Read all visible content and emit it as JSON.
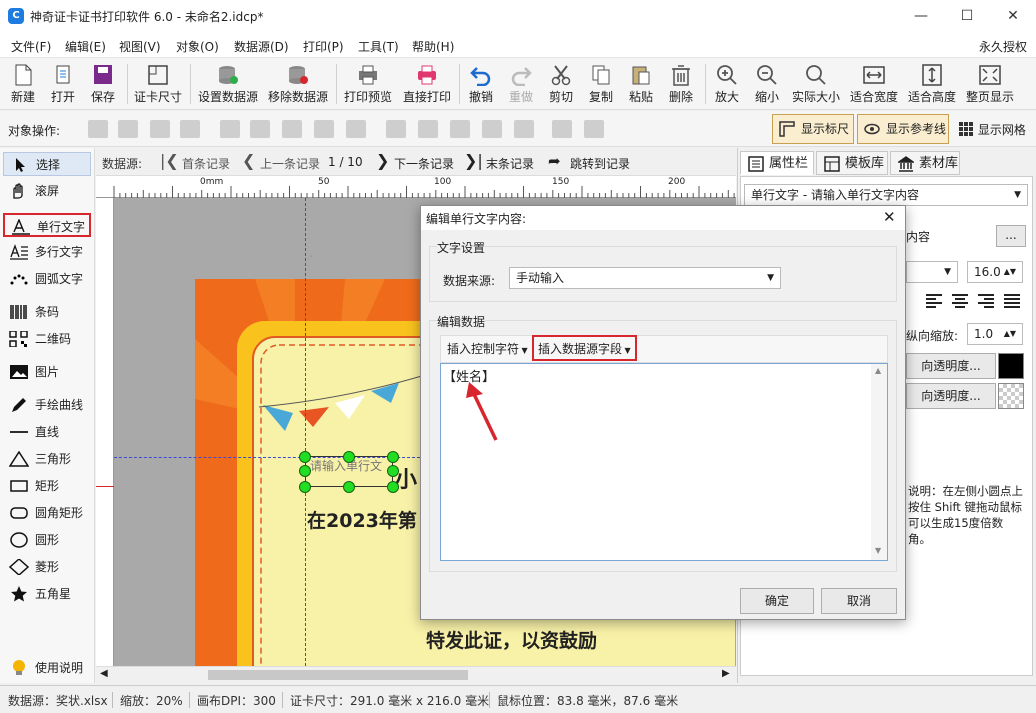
{
  "window": {
    "title": "神奇证卡证书打印软件 6.0 - 未命名2.idcp*",
    "app_icon_letter": "C"
  },
  "menu": {
    "items": [
      "文件(F)",
      "编辑(E)",
      "视图(V)",
      "对象(O)",
      "数据源(D)",
      "打印(P)",
      "工具(T)",
      "帮助(H)"
    ],
    "license": "永久授权"
  },
  "toolbar": {
    "items": [
      "新建",
      "打开",
      "保存",
      "证卡尺寸",
      "设置数据源",
      "移除数据源",
      "打印预览",
      "直接打印",
      "撤销",
      "重做",
      "剪切",
      "复制",
      "粘贴",
      "删除",
      "放大",
      "缩小",
      "实际大小",
      "适合宽度",
      "适合高度",
      "整页显示"
    ]
  },
  "ops": {
    "label": "对象操作:",
    "show_ruler": "显示标尺",
    "show_guides": "显示参考线",
    "show_grid": "显示网格"
  },
  "tools": {
    "items": [
      "选择",
      "滚屏",
      "单行文字",
      "多行文字",
      "圆弧文字",
      "条码",
      "二维码",
      "图片",
      "手绘曲线",
      "直线",
      "三角形",
      "矩形",
      "圆角矩形",
      "圆形",
      "菱形",
      "五角星"
    ],
    "help": "使用说明"
  },
  "records": {
    "label": "数据源:",
    "first": "首条记录",
    "prev": "上一条记录",
    "counter": "1 / 10",
    "next": "下一条记录",
    "last": "末条记录",
    "jump": "跳转到记录"
  },
  "ruler": {
    "marks": [
      "0mm",
      "50",
      "100",
      "150",
      "200"
    ]
  },
  "card": {
    "placeholder": "请输入单行文",
    "line1": "在2023年第",
    "line2": "特发此证，以资鼓励",
    "partial": "小"
  },
  "right_panel": {
    "tabs": [
      "属性栏",
      "模板库",
      "素材库"
    ],
    "selector": "单行文字 - 请输入单行文字内容",
    "content_suffix": "内容",
    "font_size": "16.0",
    "scale_label": "纵向缩放:",
    "scale_value": "1.0",
    "opacity1": "向透明度...",
    "opacity2": "向透明度...",
    "note": "说明：在左侧小圆点上按住 Shift 键拖动鼠标可以生成15度倍数角。"
  },
  "status": {
    "datasource": "数据源：奖状.xlsx",
    "zoom": "缩放：20%",
    "dpi": "画布DPI：300",
    "size": "证卡尺寸：291.0 毫米 x 216.0 毫米",
    "mouse": "鼠标位置：83.8 毫米，87.6 毫米"
  },
  "dialog": {
    "title": "编辑单行文字内容:",
    "text_settings": "文字设置",
    "source_label": "数据来源:",
    "source_value": "手动输入",
    "edit_data": "编辑数据",
    "insert_control": "插入控制字符",
    "insert_field": "插入数据源字段",
    "content": "【姓名】",
    "ok": "确定",
    "cancel": "取消"
  },
  "colors": {
    "accent_red": "#d7262e",
    "card_orange": "#ef6b1b",
    "card_yellow": "#f8f1a8",
    "handle_green": "#22dd22"
  }
}
